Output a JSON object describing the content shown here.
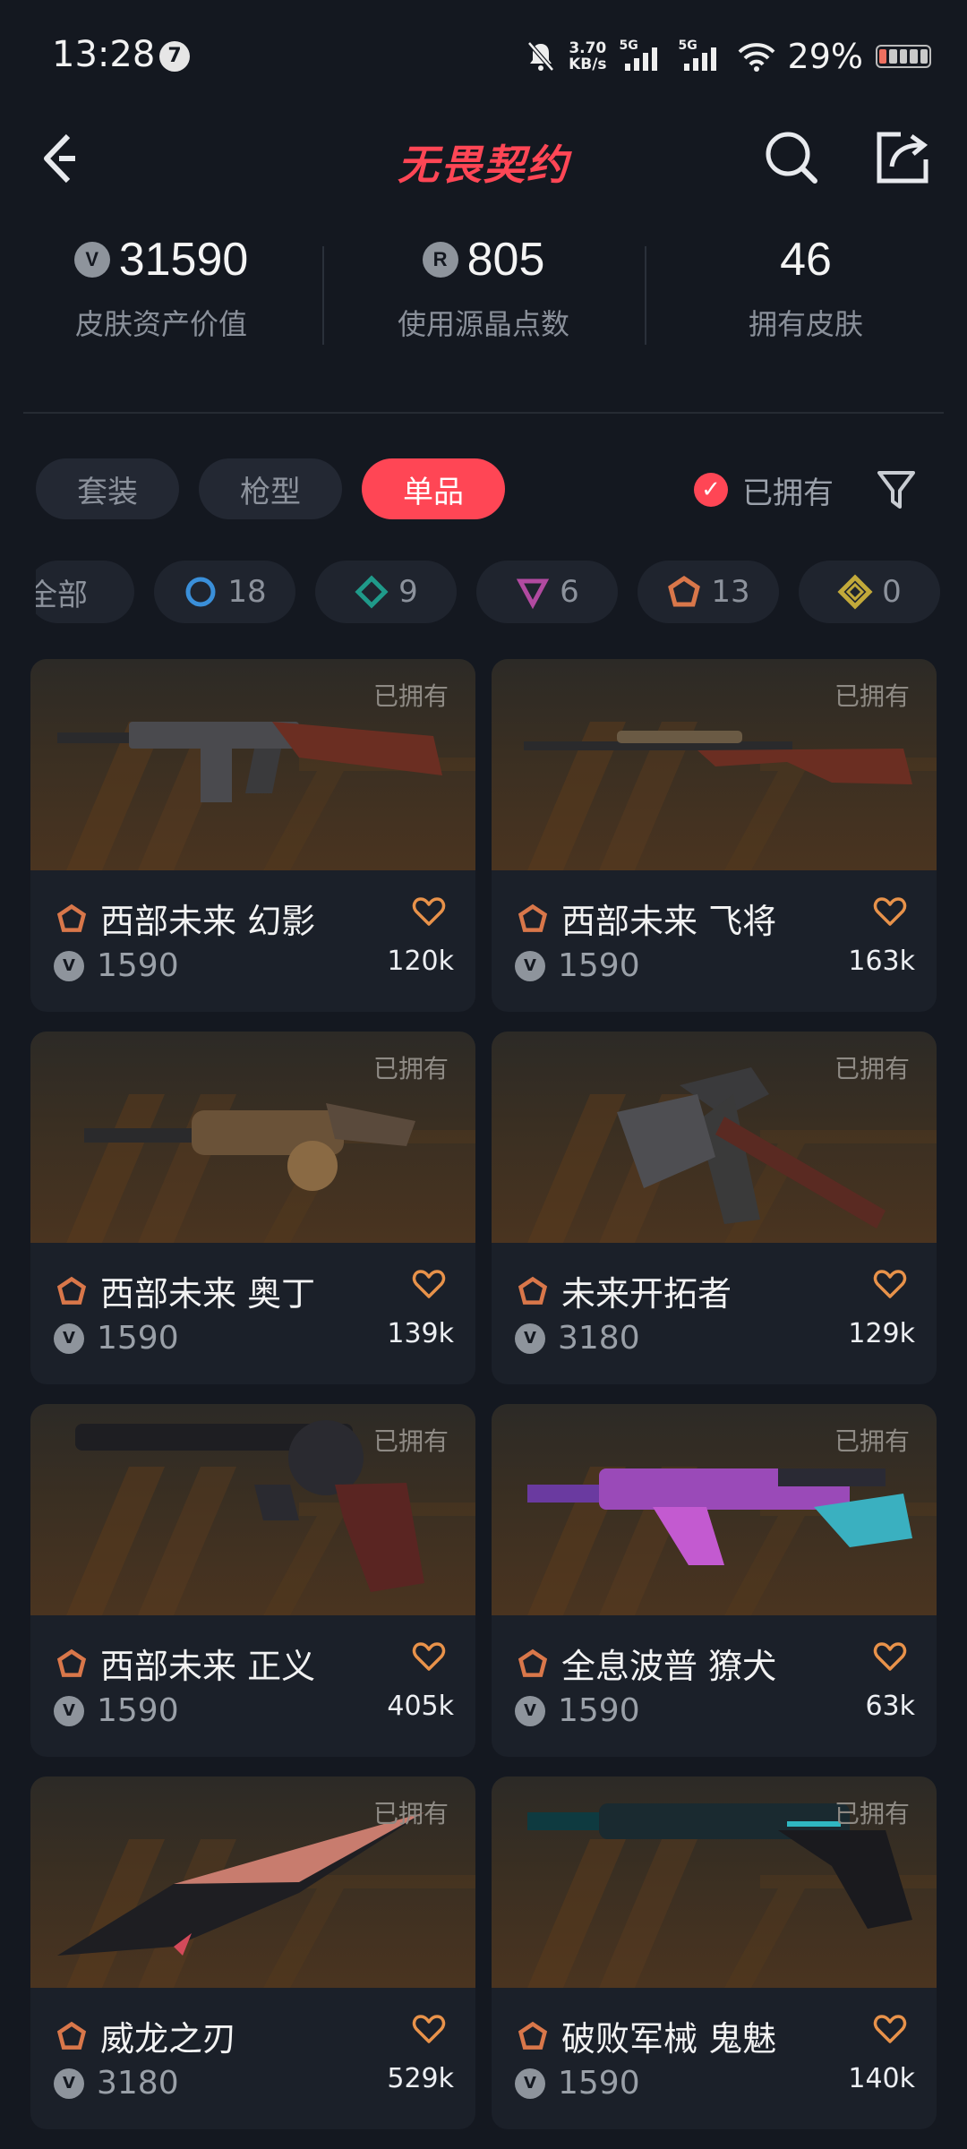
{
  "status_bar": {
    "time": "13:28",
    "notif_badge": "7",
    "net_speed_value": "3.70",
    "net_speed_unit": "KB/s",
    "sig1": "5G",
    "sig2": "5G",
    "battery_pct": "29%"
  },
  "header": {
    "title": "无畏契约"
  },
  "stats": [
    {
      "value": "31590",
      "label": "皮肤资产价值",
      "icon": "vp-coin-icon"
    },
    {
      "value": "805",
      "label": "使用源晶点数",
      "icon": "radianite-coin-icon"
    },
    {
      "value": "46",
      "label": "拥有皮肤"
    }
  ],
  "tabs": [
    {
      "label": "套装",
      "active": false
    },
    {
      "label": "枪型",
      "active": false
    },
    {
      "label": "单品",
      "active": true
    }
  ],
  "owned_filter": {
    "label": "已拥有",
    "checked": true
  },
  "tier_chips": [
    {
      "label": "全部",
      "count": ""
    },
    {
      "icon": "select-tier-icon",
      "count": "18",
      "color": "#3a8fd9"
    },
    {
      "icon": "deluxe-tier-icon",
      "count": "9",
      "color": "#1f9a8a"
    },
    {
      "icon": "premium-tier-icon",
      "count": "6",
      "color": "#b14aa0"
    },
    {
      "icon": "exclusive-tier-icon",
      "count": "13",
      "color": "#d9774a"
    },
    {
      "icon": "ultra-tier-icon",
      "count": "0",
      "color": "#c2a93a"
    }
  ],
  "skins": [
    {
      "name": "西部未来 幻影",
      "price": "1590",
      "likes": "120k",
      "owned": "已拥有"
    },
    {
      "name": "西部未来 飞将",
      "price": "1590",
      "likes": "163k",
      "owned": "已拥有"
    },
    {
      "name": "西部未来 奥丁",
      "price": "1590",
      "likes": "139k",
      "owned": "已拥有"
    },
    {
      "name": "未来开拓者",
      "price": "3180",
      "likes": "129k",
      "owned": "已拥有"
    },
    {
      "name": "西部未来 正义",
      "price": "1590",
      "likes": "405k",
      "owned": "已拥有"
    },
    {
      "name": "全息波普 獠犬",
      "price": "1590",
      "likes": "63k",
      "owned": "已拥有"
    },
    {
      "name": "威龙之刃",
      "price": "3180",
      "likes": "529k",
      "owned": "已拥有"
    },
    {
      "name": "破败军械 鬼魅",
      "price": "1590",
      "likes": "140k",
      "owned": "已拥有"
    }
  ],
  "colors": {
    "accent": "#ff4655",
    "bg": "#141820",
    "card": "#1b2029",
    "tier_exclusive": "#d9774a"
  }
}
